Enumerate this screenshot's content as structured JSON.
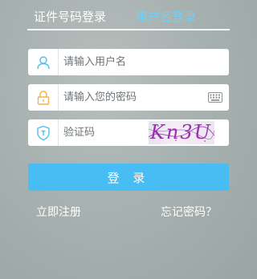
{
  "tabs": {
    "id_login": "证件号码登录",
    "user_login": "用户名登录"
  },
  "form": {
    "username_placeholder": "请输入用户名",
    "password_placeholder": "请输入您的密码",
    "captcha_placeholder": "验证码",
    "captcha_text": "Kn3U"
  },
  "actions": {
    "login_label": "登 录",
    "register_label": "立即注册",
    "forgot_label": "忘记密码？"
  },
  "icons": [
    "user-icon",
    "lock-icon",
    "keyboard-icon",
    "shield-icon"
  ],
  "colors": {
    "accent": "#48bdf3",
    "active_tab": "#6fd1f5",
    "captcha_text": "#9c2fb0"
  }
}
